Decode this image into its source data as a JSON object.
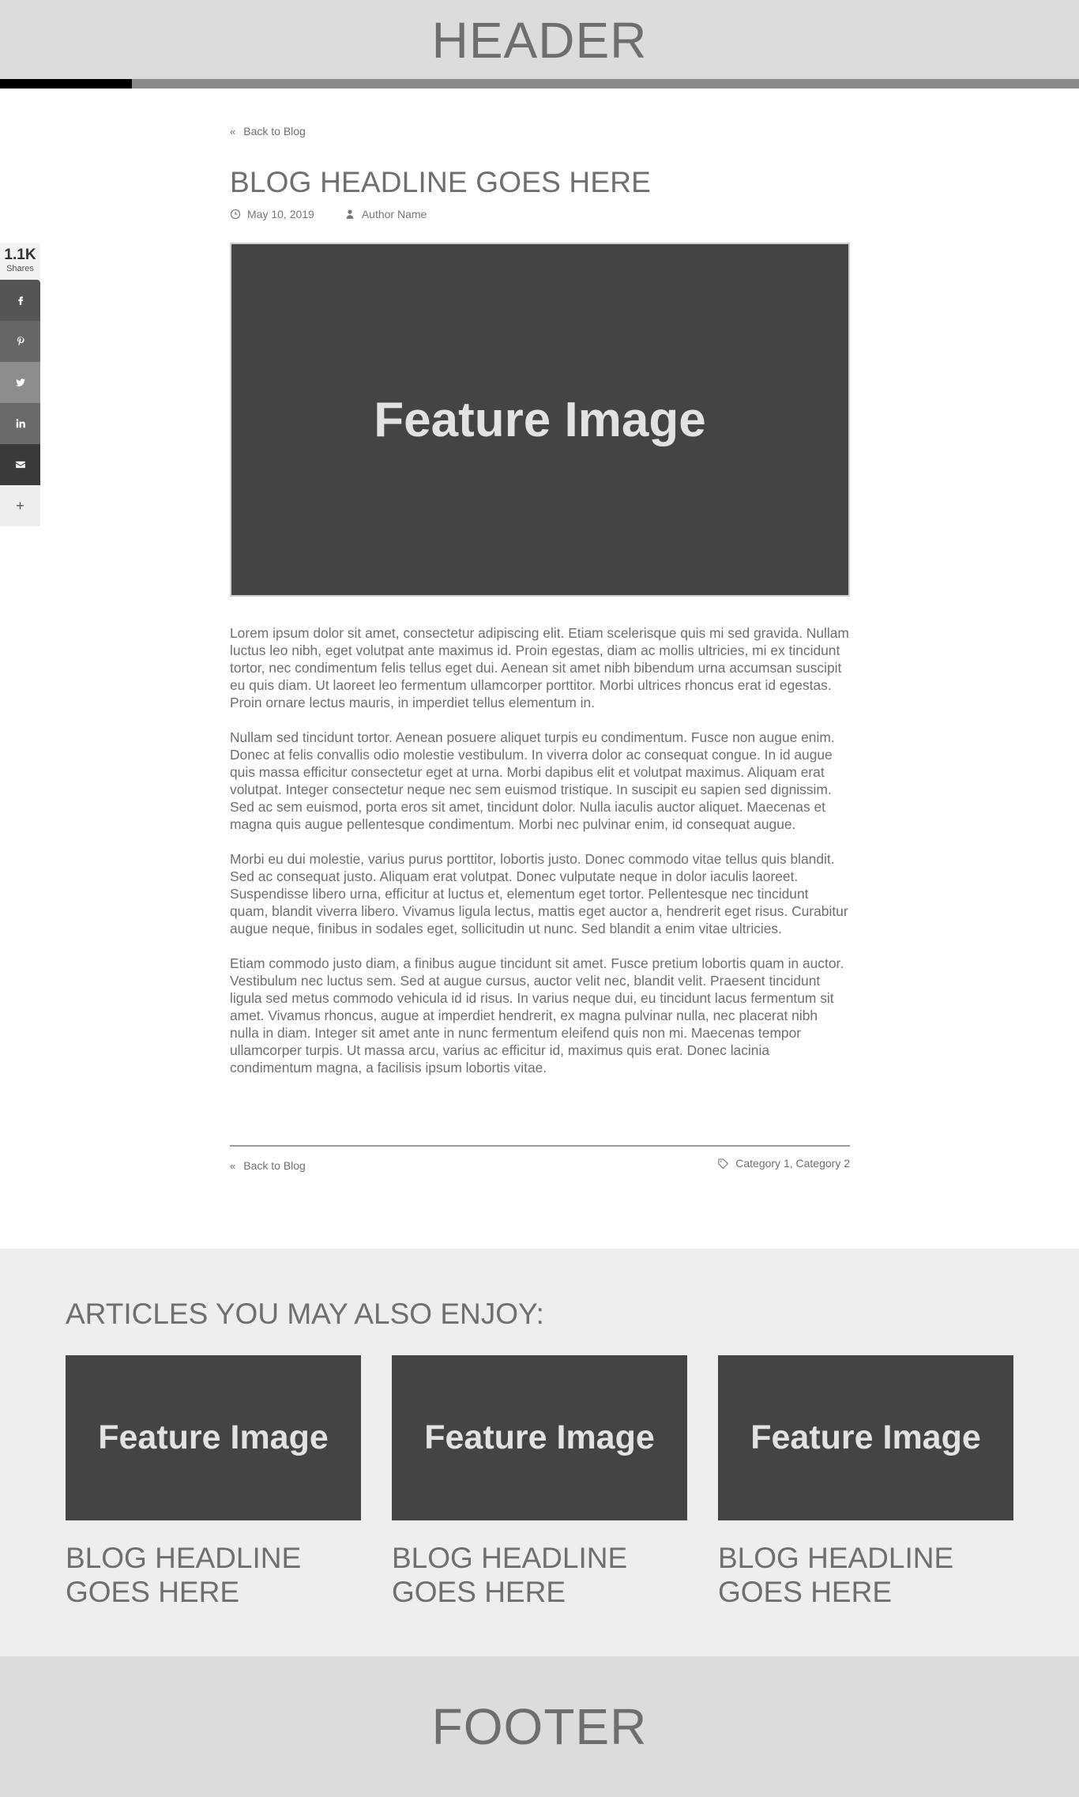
{
  "header": {
    "title": "HEADER"
  },
  "progress": {
    "read_fraction": 0.122
  },
  "share": {
    "count": "1.1K",
    "label": "Shares",
    "buttons": [
      {
        "icon": "facebook-icon",
        "color": "#555555"
      },
      {
        "icon": "pinterest-icon",
        "color": "#666666"
      },
      {
        "icon": "twitter-icon",
        "color": "#8d8d8d"
      },
      {
        "icon": "linkedin-icon",
        "color": "#6a6a6a"
      },
      {
        "icon": "email-icon",
        "color": "#3a3a3a"
      },
      {
        "icon": "plus-icon",
        "label": "+",
        "color": "#eeeeee"
      }
    ]
  },
  "article": {
    "back_label": "Back to Blog",
    "title": "BLOG HEADLINE GOES HERE",
    "date": "May 10, 2019",
    "author": "Author Name",
    "feature_label": "Feature Image",
    "paragraphs": [
      "Lorem ipsum dolor sit amet, consectetur adipiscing elit. Etiam scelerisque quis mi sed gravida. Nullam luctus leo nibh, eget volutpat ante maximus id. Proin egestas, diam ac mollis ultricies, mi ex tincidunt tortor, nec condimentum felis tellus eget dui. Aenean sit amet nibh bibendum urna accumsan suscipit eu quis diam. Ut laoreet leo fermentum ullamcorper porttitor. Morbi ultrices rhoncus erat id egestas. Proin ornare lectus mauris, in imperdiet tellus elementum in.",
      "Nullam sed tincidunt tortor. Aenean posuere aliquet turpis eu condimentum. Fusce non augue enim. Donec at felis convallis odio molestie vestibulum. In viverra dolor ac consequat congue. In id augue quis massa efficitur consectetur eget at urna. Morbi dapibus elit et volutpat maximus. Aliquam erat volutpat. Integer consectetur neque nec sem euismod tristique. In suscipit eu sapien sed dignissim. Sed ac sem euismod, porta eros sit amet, tincidunt dolor. Nulla iaculis auctor aliquet. Maecenas et magna quis augue pellentesque condimentum. Morbi nec pulvinar enim, id consequat augue.",
      "Morbi eu dui molestie, varius purus porttitor, lobortis justo. Donec commodo vitae tellus quis blandit. Sed ac consequat justo. Aliquam erat volutpat. Donec vulputate neque in dolor iaculis laoreet. Suspendisse libero urna, efficitur at luctus et, elementum eget tortor. Pellentesque nec tincidunt quam, blandit viverra libero. Vivamus ligula lectus, mattis eget auctor a, hendrerit eget risus. Curabitur augue neque, finibus in sodales eget, sollicitudin ut nunc. Sed blandit a enim vitae ultricies.",
      "Etiam commodo justo diam, a finibus augue tincidunt sit amet. Fusce pretium lobortis quam in auctor. Vestibulum nec luctus sem. Sed at augue cursus, auctor velit nec, blandit velit. Praesent tincidunt ligula sed metus commodo vehicula id id risus. In varius neque dui, eu tincidunt lacus fermentum sit amet. Vivamus rhoncus, augue at imperdiet hendrerit, ex magna pulvinar nulla, nec placerat nibh nulla in diam. Integer sit amet ante in nunc fermentum eleifend quis non mi. Maecenas tempor ullamcorper turpis. Ut massa arcu, varius ac efficitur id, maximus quis erat. Donec lacinia condimentum magna, a facilisis ipsum lobortis vitae."
    ],
    "categories": "Category 1, Category 2"
  },
  "related": {
    "title": "ARTICLES YOU MAY ALSO ENJOY:",
    "cards": [
      {
        "image_label": "Feature Image",
        "headline": "BLOG HEADLINE GOES HERE"
      },
      {
        "image_label": "Feature Image",
        "headline": "BLOG HEADLINE GOES HERE"
      },
      {
        "image_label": "Feature Image",
        "headline": "BLOG HEADLINE GOES HERE"
      }
    ]
  },
  "footer": {
    "title": "FOOTER"
  }
}
